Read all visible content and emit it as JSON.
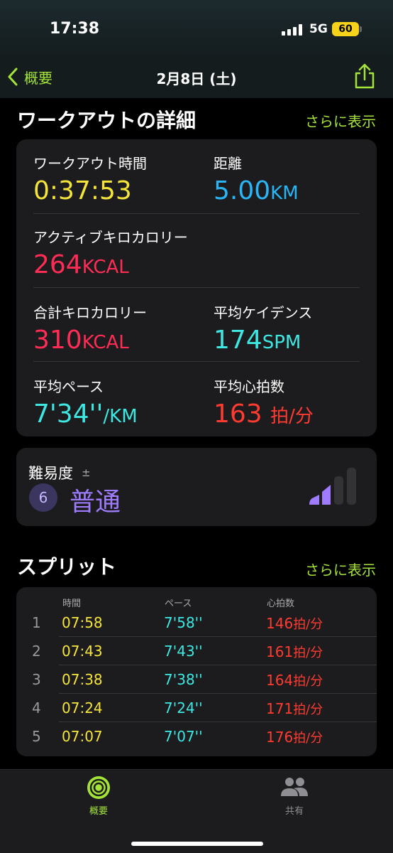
{
  "status": {
    "time": "17:38",
    "network": "5G",
    "battery": "60"
  },
  "nav": {
    "back_label": "概要",
    "title": "2月8日 (土)"
  },
  "details": {
    "title": "ワークアウトの詳細",
    "more": "さらに表示",
    "workout_time": {
      "label": "ワークアウト時間",
      "value": "0:37:53"
    },
    "distance": {
      "label": "距離",
      "value": "5.00",
      "unit": "KM"
    },
    "active_cal": {
      "label": "アクティブキロカロリー",
      "value": "264",
      "unit": "KCAL"
    },
    "total_cal": {
      "label": "合計キロカロリー",
      "value": "310",
      "unit": "KCAL"
    },
    "cadence": {
      "label": "平均ケイデンス",
      "value": "174",
      "unit": "SPM"
    },
    "pace": {
      "label": "平均ペース",
      "value": "7'34''",
      "unit": "/KM"
    },
    "heart_rate": {
      "label": "平均心拍数",
      "value": "163",
      "unit": "拍/分"
    }
  },
  "difficulty": {
    "label": "難易度",
    "symbol": "±",
    "level": "6",
    "value": "普通",
    "bar_level": 2,
    "bar_max": 4
  },
  "splits": {
    "title": "スプリット",
    "more": "さらに表示",
    "headers": {
      "time": "時間",
      "pace": "ペース",
      "hr": "心拍数"
    },
    "rows": [
      {
        "n": "1",
        "time": "07:58",
        "pace": "7'58''",
        "hr": "146",
        "hr_unit": "拍/分"
      },
      {
        "n": "2",
        "time": "07:43",
        "pace": "7'43''",
        "hr": "161",
        "hr_unit": "拍/分"
      },
      {
        "n": "3",
        "time": "07:38",
        "pace": "7'38''",
        "hr": "164",
        "hr_unit": "拍/分"
      },
      {
        "n": "4",
        "time": "07:24",
        "pace": "7'24''",
        "hr": "171",
        "hr_unit": "拍/分"
      },
      {
        "n": "5",
        "time": "07:07",
        "pace": "7'07''",
        "hr": "176",
        "hr_unit": "拍/分"
      }
    ]
  },
  "tabs": {
    "summary": "概要",
    "sharing": "共有"
  },
  "colors": {
    "accent": "#a4e438",
    "yellow": "#f5e43a",
    "blue": "#29b5f6",
    "pink": "#ff2d55",
    "cyan": "#3ee7e2",
    "red": "#ff3b30",
    "purple": "#9e7bff"
  }
}
